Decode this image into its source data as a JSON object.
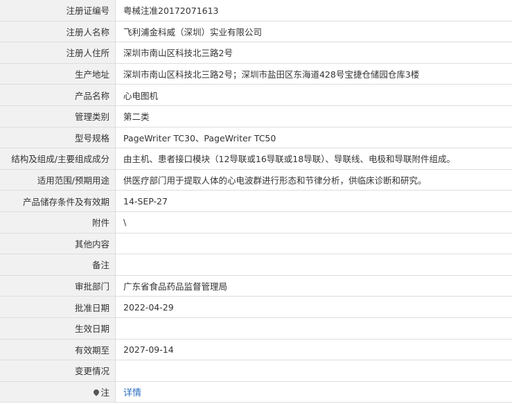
{
  "rows": [
    {
      "label": "注册证编号",
      "value": "粤械注准20172071613"
    },
    {
      "label": "注册人名称",
      "value": "飞利浦金科威（深圳）实业有限公司"
    },
    {
      "label": "注册人住所",
      "value": "深圳市南山区科技北三路2号"
    },
    {
      "label": "生产地址",
      "value": "深圳市南山区科技北三路2号；深圳市盐田区东海道428号宝捷仓储园仓库3楼"
    },
    {
      "label": "产品名称",
      "value": "心电图机"
    },
    {
      "label": "管理类别",
      "value": "第二类"
    },
    {
      "label": "型号规格",
      "value": "PageWriter TC30、PageWriter TC50"
    },
    {
      "label": "结构及组成/主要组成成分",
      "value": "由主机、患者接口模块（12导联或16导联或18导联）、导联线、电极和导联附件组成。"
    },
    {
      "label": "适用范围/预期用途",
      "value": "供医疗部门用于提取人体的心电波群进行形态和节律分析，供临床诊断和研究。"
    },
    {
      "label": "产品储存条件及有效期",
      "value": "14-SEP-27"
    },
    {
      "label": "附件",
      "value": "\\"
    },
    {
      "label": "其他内容",
      "value": ""
    },
    {
      "label": "备注",
      "value": ""
    },
    {
      "label": "审批部门",
      "value": "广东省食品药品监督管理局"
    },
    {
      "label": "批准日期",
      "value": "2022-04-29"
    },
    {
      "label": "生效日期",
      "value": ""
    },
    {
      "label": "有效期至",
      "value": "2027-09-14"
    },
    {
      "label": "变更情况",
      "value": ""
    }
  ],
  "note": {
    "label": "注",
    "icon": "pin-icon",
    "link_text": "详情"
  }
}
